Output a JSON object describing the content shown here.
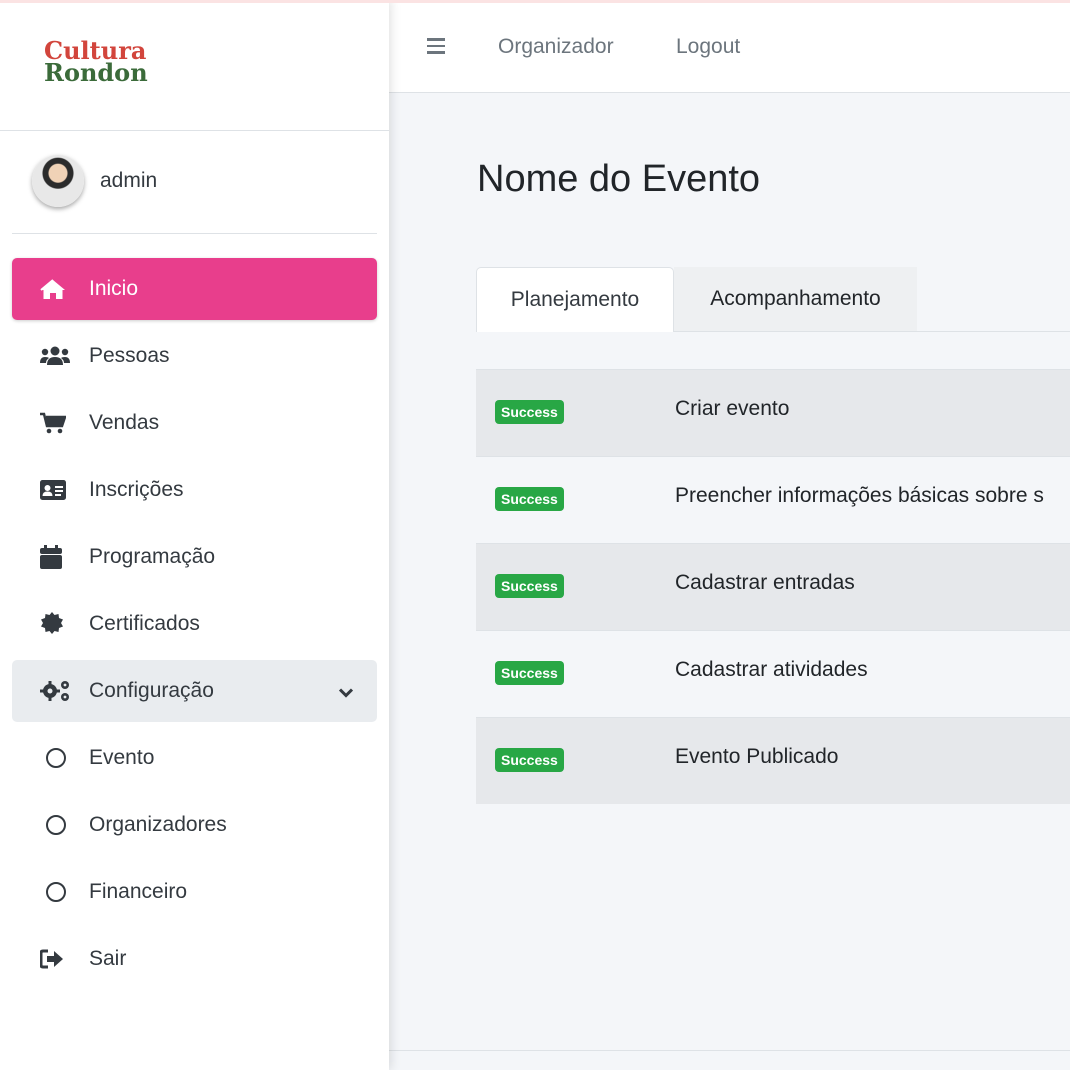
{
  "brand": {
    "line1": "Cultura",
    "line2": "Rondon"
  },
  "user": {
    "name": "admin"
  },
  "sidebar": {
    "items": [
      {
        "label": "Inicio",
        "icon": "home-icon"
      },
      {
        "label": "Pessoas",
        "icon": "users-icon"
      },
      {
        "label": "Vendas",
        "icon": "shopping-cart-icon"
      },
      {
        "label": "Inscrições",
        "icon": "id-card-icon"
      },
      {
        "label": "Programação",
        "icon": "calendar-icon"
      },
      {
        "label": "Certificados",
        "icon": "certificate-icon"
      },
      {
        "label": "Configuração",
        "icon": "cogs-icon"
      },
      {
        "label": "Evento",
        "icon": "circle-icon"
      },
      {
        "label": "Organizadores",
        "icon": "circle-icon"
      },
      {
        "label": "Financeiro",
        "icon": "circle-icon"
      },
      {
        "label": "Sair",
        "icon": "sign-out-icon"
      }
    ]
  },
  "header": {
    "links": [
      "Organizador",
      "Logout"
    ]
  },
  "page": {
    "title": "Nome do Evento"
  },
  "tabs": [
    {
      "label": "Planejamento"
    },
    {
      "label": "Acompanhamento"
    }
  ],
  "tasks": [
    {
      "status": "Success",
      "label": "Criar evento"
    },
    {
      "status": "Success",
      "label": "Preencher informações básicas sobre s"
    },
    {
      "status": "Success",
      "label": "Cadastrar entradas"
    },
    {
      "status": "Success",
      "label": "Cadastrar atividades"
    },
    {
      "status": "Success",
      "label": "Evento Publicado"
    }
  ],
  "colors": {
    "accent": "#e83e8c",
    "success": "#28a745"
  }
}
